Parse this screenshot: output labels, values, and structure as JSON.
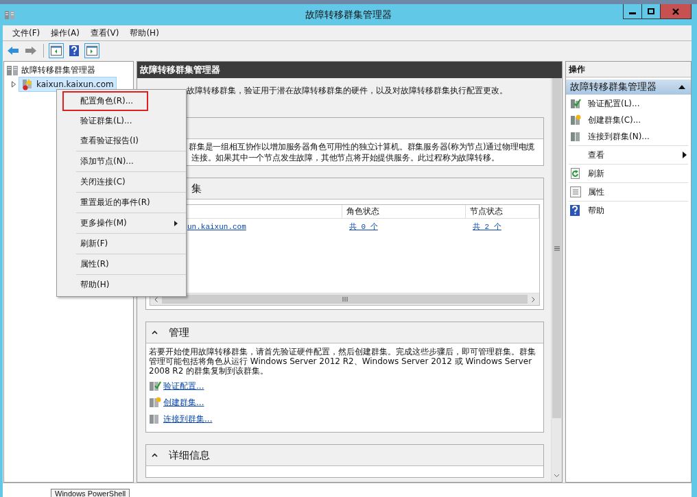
{
  "window": {
    "title": "故障转移群集管理器"
  },
  "menu_bar": [
    "文件(F)",
    "操作(A)",
    "查看(V)",
    "帮助(H)"
  ],
  "tree": {
    "root": {
      "label": "故障转移群集管理器",
      "children": [
        {
          "label": "kaixun.kaixun.com",
          "selected": true,
          "expanded": false
        }
      ]
    }
  },
  "context_menu": {
    "groups": [
      [
        {
          "label": "配置角色(R)...",
          "highlighted": true,
          "submenu": false
        },
        {
          "label": "验证群集(L)...",
          "highlighted": false,
          "submenu": false
        },
        {
          "label": "查看验证报告(I)",
          "highlighted": false,
          "submenu": false
        }
      ],
      [
        {
          "label": "添加节点(N)...",
          "highlighted": false,
          "submenu": false
        }
      ],
      [
        {
          "label": "关闭连接(C)",
          "highlighted": false,
          "submenu": false
        }
      ],
      [
        {
          "label": "重置最近的事件(R)",
          "highlighted": false,
          "submenu": false
        }
      ],
      [
        {
          "label": "更多操作(M)",
          "highlighted": false,
          "submenu": true
        }
      ],
      [
        {
          "label": "刷新(F)",
          "highlighted": false,
          "submenu": false
        }
      ],
      [
        {
          "label": "属性(R)",
          "highlighted": false,
          "submenu": false
        }
      ],
      [
        {
          "label": "帮助(H)",
          "highlighted": false,
          "submenu": false
        }
      ]
    ]
  },
  "center": {
    "title": "故障转移群集管理器",
    "intro": "故障转移群集，验证用于潜在故障转移群集的硬件，以及对故障转移群集执行配置更改。",
    "sections": [
      {
        "kind": "text",
        "lines": [
          "群集是一组相互协作以增加服务器角色可用性的独立计算机。群集服务器(称为节点)通过物理电缆",
          "连接。如果其中一个节点发生故障，其他节点将开始提供服务。此过程称为故障转移。"
        ]
      },
      {
        "kind": "table",
        "title": "集",
        "columns": [
          "角色状态",
          "节点状态"
        ],
        "rows": [
          {
            "name": "un.kaixun.com",
            "roles": "共 0 个",
            "nodes": "共 2 个"
          }
        ]
      },
      {
        "kind": "links",
        "title": "管理",
        "text": "若要开始使用故障转移群集，请首先验证硬件配置，然后创建群集。完成这些步骤后，即可管理群集。群集管理可能包括将角色从运行 Windows Server 2012 R2、Windows Server 2012 或 Windows Server 2008 R2 的群集复制到该群集。",
        "links": [
          {
            "label": "验证配置...",
            "kind": "verify"
          },
          {
            "label": "创建群集...",
            "kind": "create"
          },
          {
            "label": "连接到群集...",
            "kind": "connect"
          }
        ]
      },
      {
        "kind": "header",
        "title": "详细信息"
      }
    ]
  },
  "actions": {
    "header": "操作",
    "group_title": "故障转移群集管理器",
    "groups": [
      [
        {
          "label": "验证配置(L)...",
          "kind": "verify",
          "submenu": false
        },
        {
          "label": "创建群集(C)...",
          "kind": "create",
          "submenu": false
        },
        {
          "label": "连接到群集(N)...",
          "kind": "connect",
          "submenu": false
        }
      ],
      [
        {
          "label": "查看",
          "kind": "none",
          "submenu": true
        }
      ],
      [
        {
          "label": "刷新",
          "kind": "refresh",
          "submenu": false
        }
      ],
      [
        {
          "label": "属性",
          "kind": "properties",
          "submenu": false
        }
      ],
      [
        {
          "label": "帮助",
          "kind": "help",
          "submenu": false
        }
      ]
    ]
  },
  "status_bar": {
    "tooltip": "Windows PowerShell"
  }
}
